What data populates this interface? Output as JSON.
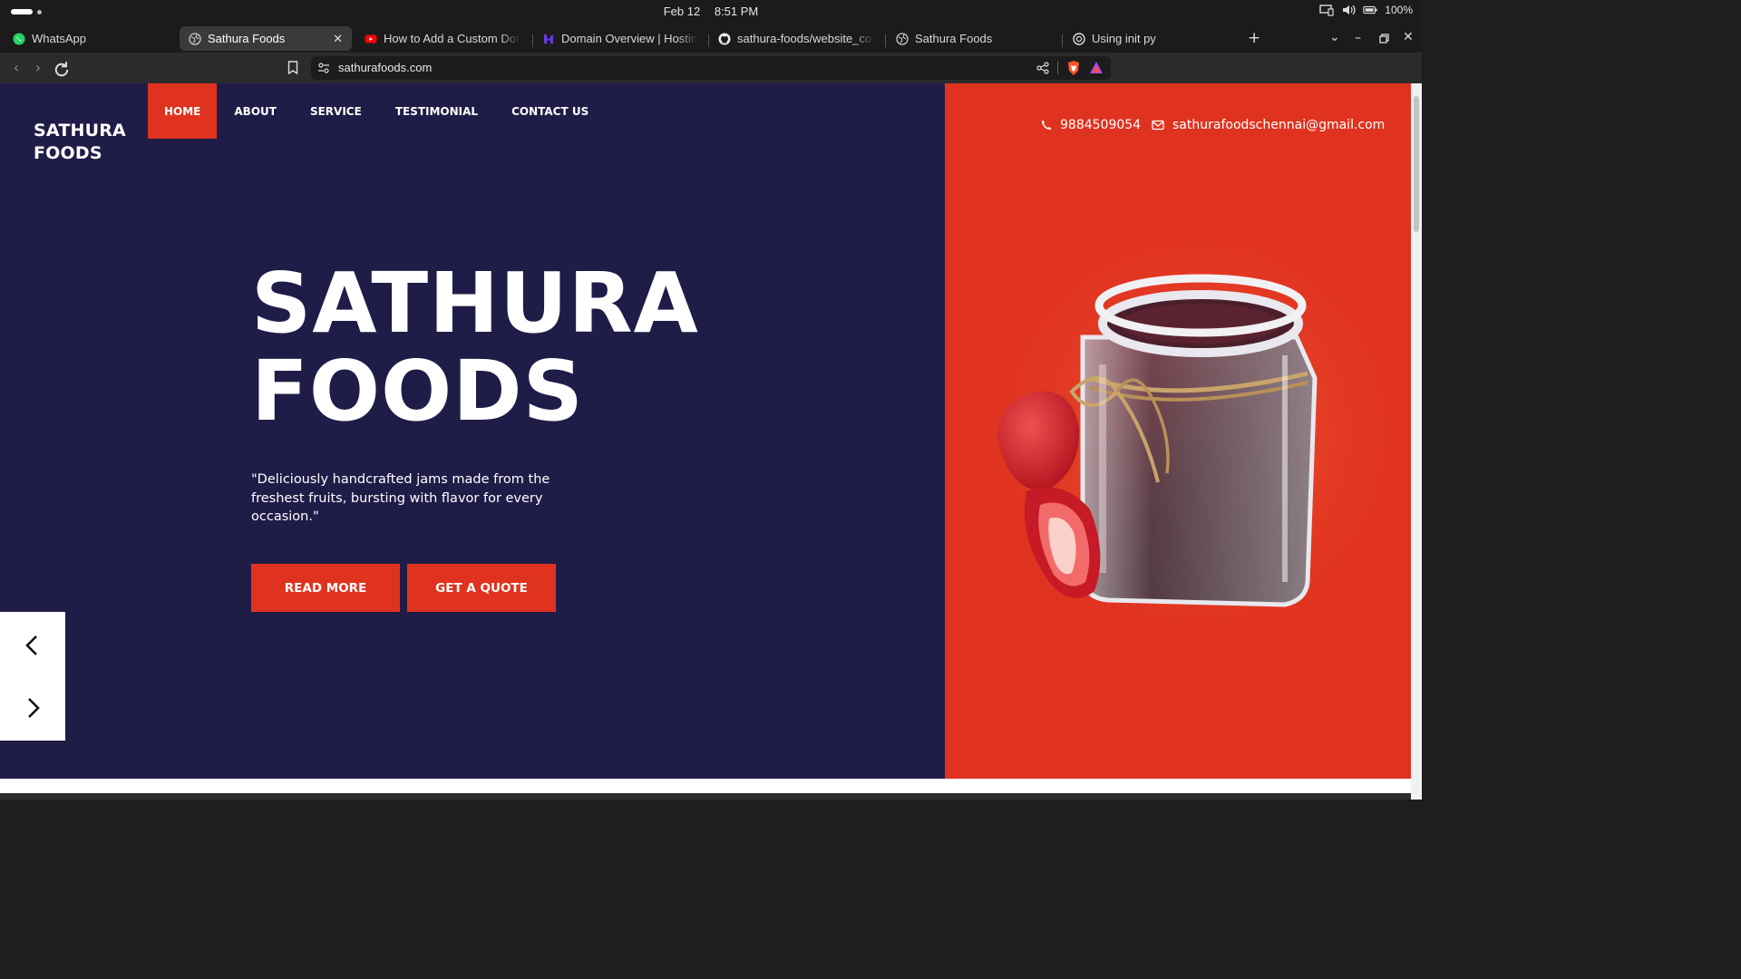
{
  "os": {
    "date": "Feb 12",
    "time": "8:51 PM",
    "battery": "100%"
  },
  "tabs": [
    {
      "title": "WhatsApp",
      "icon": "whatsapp-icon"
    },
    {
      "title": "Sathura Foods",
      "icon": "globe-icon",
      "active": true
    },
    {
      "title": "How to Add a Custom Doma",
      "icon": "youtube-icon"
    },
    {
      "title": "Domain Overview | Hostinge",
      "icon": "hostinger-icon"
    },
    {
      "title": "sathura-foods/website_code",
      "icon": "github-icon"
    },
    {
      "title": "Sathura Foods",
      "icon": "globe-icon"
    },
    {
      "title": "Using init py",
      "icon": "openai-icon"
    }
  ],
  "address_bar": {
    "url": "sathurafoods.com"
  },
  "site": {
    "logo": [
      "SATHURA",
      "FOODS"
    ],
    "nav": [
      "HOME",
      "ABOUT",
      "SERVICE",
      "TESTIMONIAL",
      "CONTACT US"
    ],
    "active_nav": "HOME",
    "phone": "9884509054",
    "email": "sathurafoodschennai@gmail.com",
    "hero_title": [
      "SATHURA",
      "FOODS"
    ],
    "tagline": "\"Deliciously handcrafted jams made from the freshest fruits, bursting with flavor for every occasion.\"",
    "buttons": {
      "read_more": "READ MORE",
      "get_quote": "GET A QUOTE"
    },
    "image": "strawberry-jam-jar-image"
  },
  "colors": {
    "navy": "#201c48",
    "red": "#e0331f",
    "white": "#ffffff"
  }
}
